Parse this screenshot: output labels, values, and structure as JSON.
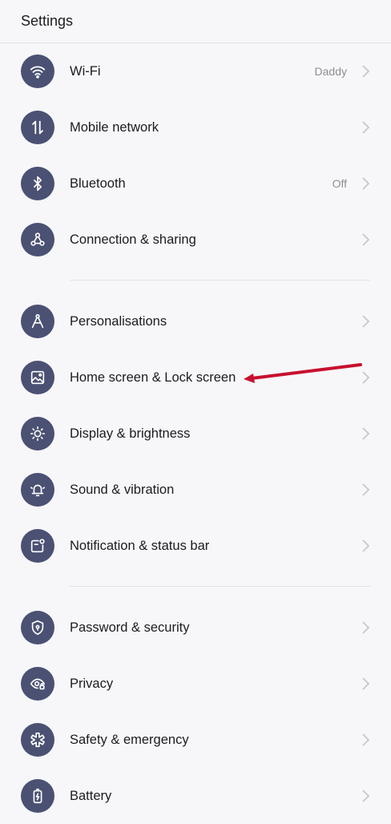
{
  "header": {
    "title": "Settings"
  },
  "groups": [
    {
      "items": [
        {
          "label": "Wi-Fi",
          "value": "Daddy",
          "icon": "wifi-icon"
        },
        {
          "label": "Mobile network",
          "value": "",
          "icon": "mobile-data-icon"
        },
        {
          "label": "Bluetooth",
          "value": "Off",
          "icon": "bluetooth-icon"
        },
        {
          "label": "Connection & sharing",
          "value": "",
          "icon": "share-icon"
        }
      ]
    },
    {
      "items": [
        {
          "label": "Personalisations",
          "value": "",
          "icon": "compass-icon"
        },
        {
          "label": "Home screen & Lock screen",
          "value": "",
          "icon": "image-icon"
        },
        {
          "label": "Display & brightness",
          "value": "",
          "icon": "brightness-icon"
        },
        {
          "label": "Sound & vibration",
          "value": "",
          "icon": "bell-icon"
        },
        {
          "label": "Notification & status bar",
          "value": "",
          "icon": "notification-icon"
        }
      ]
    },
    {
      "items": [
        {
          "label": "Password & security",
          "value": "",
          "icon": "shield-icon"
        },
        {
          "label": "Privacy",
          "value": "",
          "icon": "eye-lock-icon"
        },
        {
          "label": "Safety & emergency",
          "value": "",
          "icon": "emergency-icon"
        },
        {
          "label": "Battery",
          "value": "",
          "icon": "battery-icon"
        }
      ]
    }
  ],
  "colors": {
    "icon_bg": "#4a5173",
    "annotation_arrow": "#c8102e",
    "chevron": "#c7c7cc",
    "background": "#f7f7fa"
  }
}
